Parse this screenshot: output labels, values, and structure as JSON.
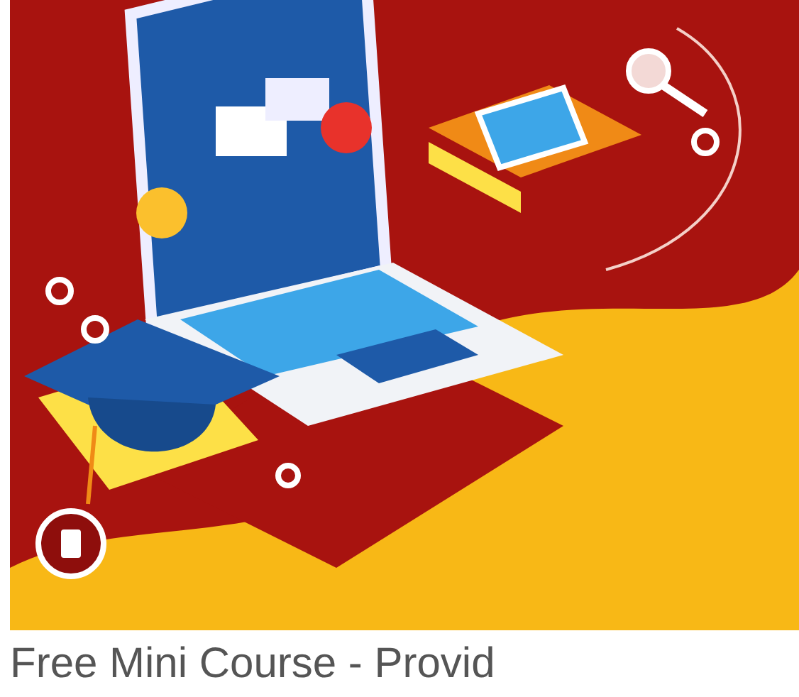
{
  "card": {
    "title": "Free Mini Course - Provid"
  }
}
